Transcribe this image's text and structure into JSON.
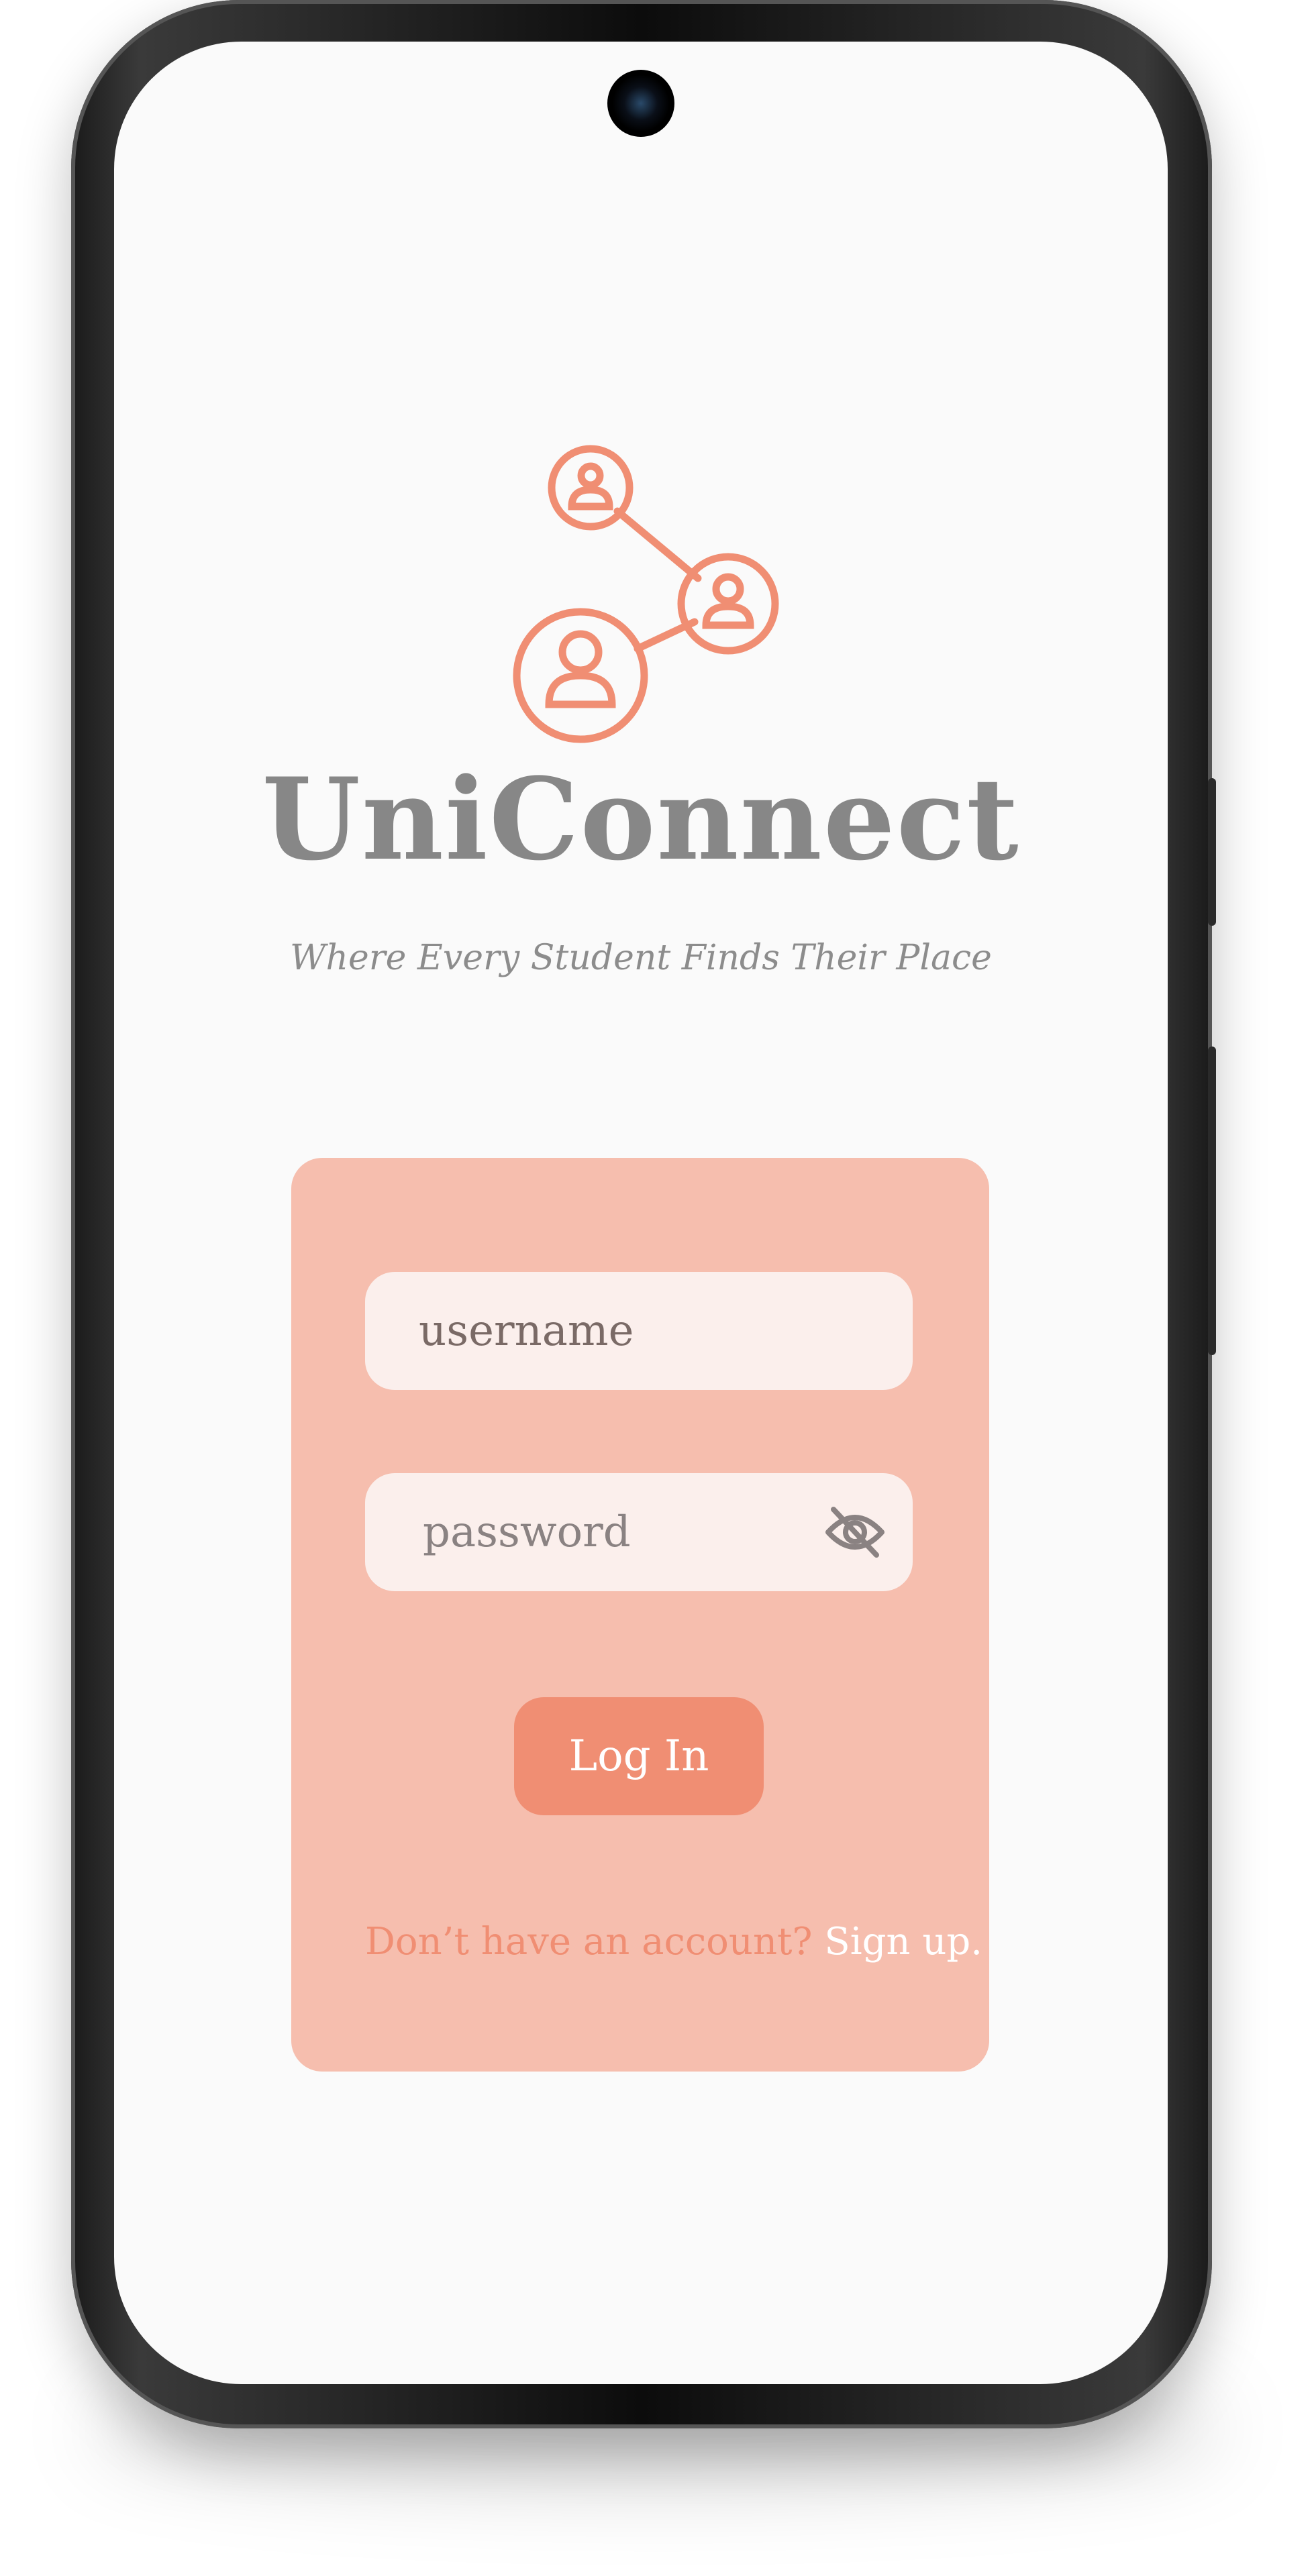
{
  "app": {
    "title": "UniConnect",
    "tagline": "Where Every Student Finds Their Place"
  },
  "login": {
    "username_placeholder": "username",
    "password_placeholder": "password",
    "login_button": "Log In",
    "signup_prompt": "Don’t have an account?",
    "signup_link": "Sign up."
  },
  "icons": {
    "logo": "people-network-icon",
    "password_toggle": "eye-off-icon"
  },
  "colors": {
    "accent": "#f08e73",
    "card": "#f6beae",
    "field": "#fbefec",
    "title": "#878787",
    "background": "#fafafa"
  }
}
